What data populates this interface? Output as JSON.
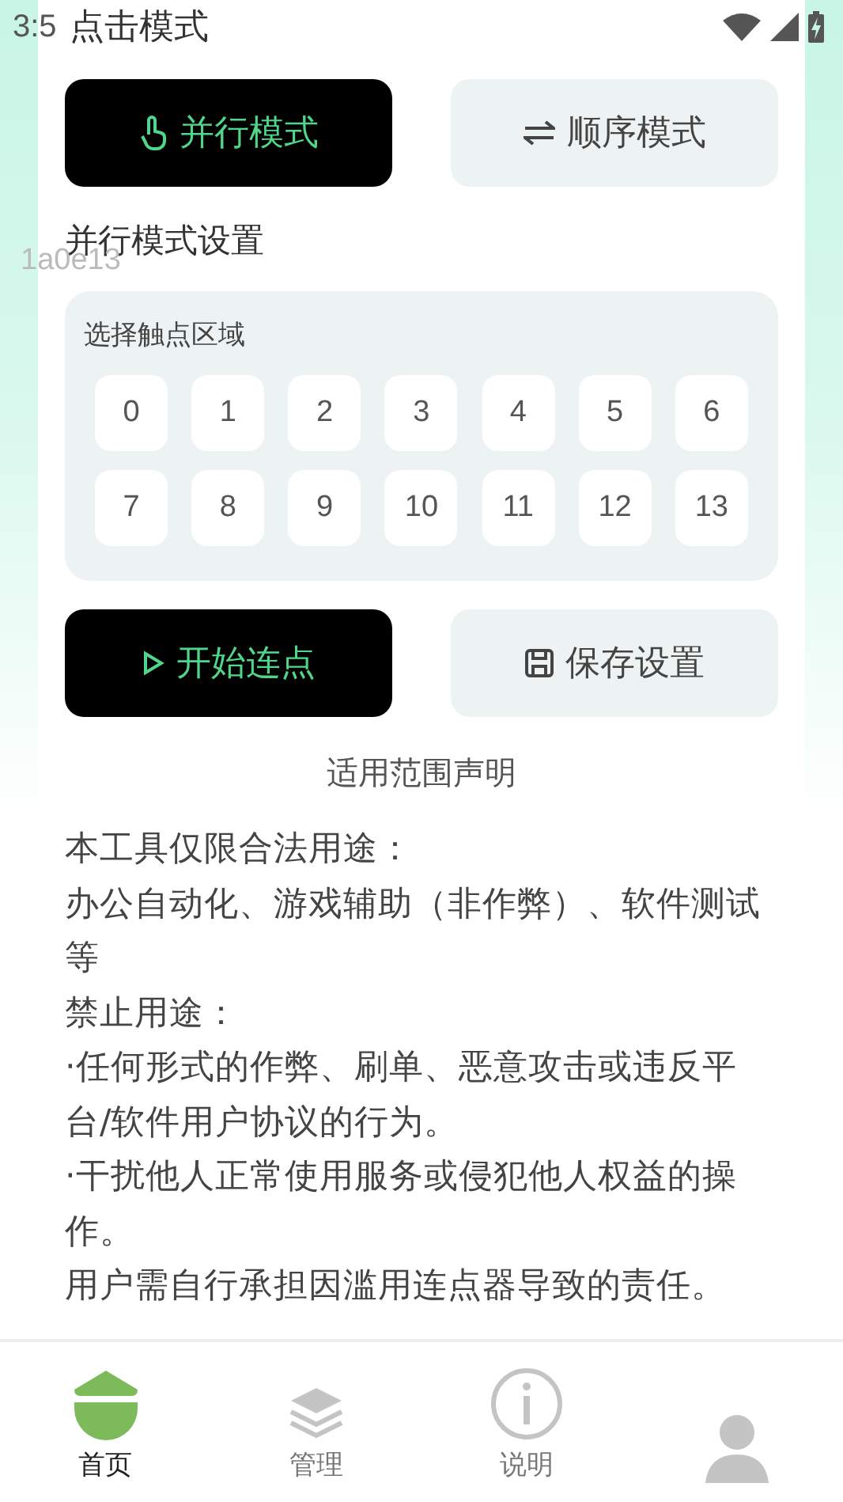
{
  "status_bar": {
    "time": "3:5"
  },
  "title": "点击模式",
  "overlay_code": "1a0e13",
  "modes": [
    {
      "label": "并行模式",
      "kind": "hand",
      "selected": true
    },
    {
      "label": "顺序模式",
      "kind": "swap",
      "selected": false
    }
  ],
  "section_title": "并行模式设置",
  "zone_panel": {
    "label": "选择触点区域",
    "zones": [
      {
        "label": "0",
        "selected": false
      },
      {
        "label": "1",
        "selected": false
      },
      {
        "label": "2",
        "selected": false
      },
      {
        "label": "3",
        "selected": false
      },
      {
        "label": "4",
        "selected": false
      },
      {
        "label": "5",
        "selected": false
      },
      {
        "label": "6",
        "selected": false
      },
      {
        "label": "7",
        "selected": false
      },
      {
        "label": "8",
        "selected": false
      },
      {
        "label": "9",
        "selected": false
      },
      {
        "label": "10",
        "selected": false
      },
      {
        "label": "11",
        "selected": false
      },
      {
        "label": "12",
        "selected": false
      },
      {
        "label": "13",
        "selected": false
      }
    ]
  },
  "actions": [
    {
      "label": "开始连点",
      "kind": "primary"
    },
    {
      "label": "保存设置",
      "kind": "secondary"
    }
  ],
  "notice_title": "适用范围声明",
  "notice_lines": [
    "本工具仅限合法用途：",
    "办公自动化、游戏辅助（非作弊）、软件测试等",
    "禁止用途：",
    "·任何形式的作弊、刷单、恶意攻击或违反平台/软件用户协议的行为。",
    "·干扰他人正常使用服务或侵犯他人权益的操作。",
    "用户需自行承担因滥用连点器导致的责任。"
  ],
  "nav": [
    {
      "label": "首页",
      "kind": "home",
      "selected": true
    },
    {
      "label": "管理",
      "kind": "layers",
      "selected": false
    },
    {
      "label": "说明",
      "kind": "info",
      "selected": false
    },
    {
      "kind": "person",
      "selected": false
    }
  ]
}
